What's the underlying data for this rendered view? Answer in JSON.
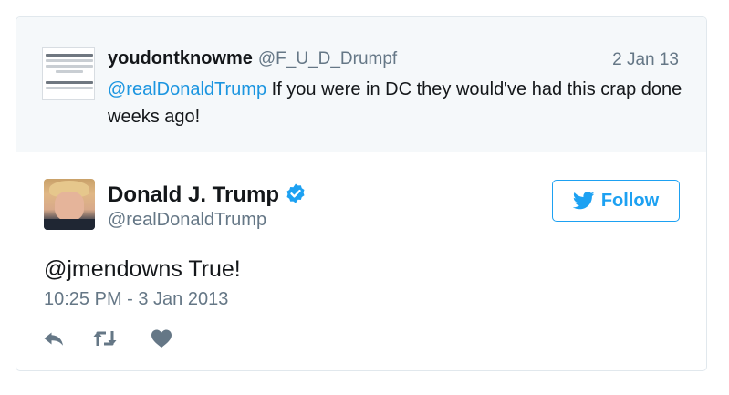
{
  "parent_tweet": {
    "display_name": "youdontknowme",
    "handle": "@F_U_D_Drumpf",
    "date": "2 Jan 13",
    "mention": "@realDonaldTrump",
    "text": " If you were in DC they would've had this crap done weeks ago!"
  },
  "main_tweet": {
    "display_name": "Donald J. Trump",
    "handle": "@realDonaldTrump",
    "follow_label": "Follow",
    "text": "@jmendowns True!",
    "timestamp": "10:25 PM - 3 Jan 2013"
  },
  "icons": {
    "verified": "verified-badge-icon",
    "follow": "twitter-bird-icon",
    "reply": "reply-icon",
    "retweet": "retweet-icon",
    "like": "heart-icon"
  },
  "colors": {
    "accent": "#1da1f2",
    "mention": "#1b95e0",
    "secondary_text": "#657786",
    "action_icon": "#657786",
    "parent_background": "#f5f8fa",
    "border": "#e1e8ed"
  }
}
